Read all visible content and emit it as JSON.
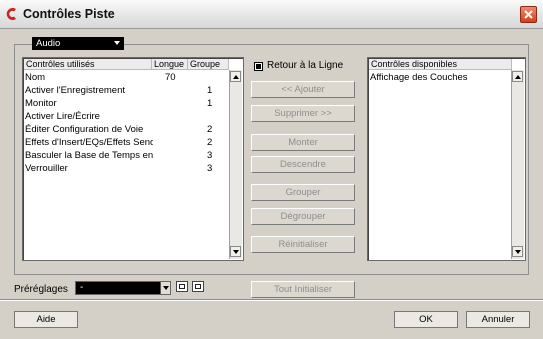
{
  "window": {
    "title": "Contrôles Piste"
  },
  "track_type_dropdown": {
    "value": "Audio"
  },
  "used_controls": {
    "headers": [
      "Contrôles utilisés",
      "Longue",
      "Groupe"
    ],
    "rows": [
      {
        "name": "Nom",
        "longue": "70",
        "groupe": ""
      },
      {
        "name": "Activer l'Enregistrement",
        "longue": "",
        "groupe": "1"
      },
      {
        "name": "Monitor",
        "longue": "",
        "groupe": "1"
      },
      {
        "name": "Activer Lire/Écrire",
        "longue": "",
        "groupe": ""
      },
      {
        "name": "Éditer Configuration de Voie",
        "longue": "",
        "groupe": "2"
      },
      {
        "name": "Effets d'Insert/EQs/Effets Send",
        "longue": "",
        "groupe": "2"
      },
      {
        "name": "Basculer la Base de Temps enti",
        "longue": "",
        "groupe": "3"
      },
      {
        "name": "Verrouiller",
        "longue": "",
        "groupe": "3"
      }
    ]
  },
  "wrap_checkbox": {
    "label": "Retour à la Ligne",
    "checked": true
  },
  "buttons": {
    "add": "<< Ajouter",
    "remove": "Supprimer >>",
    "move_up": "Monter",
    "move_down": "Descendre",
    "group": "Grouper",
    "ungroup": "Dégrouper",
    "reset": "Réinitialiser",
    "reset_all": "Tout Initialiser",
    "help": "Aide",
    "ok": "OK",
    "cancel": "Annuler"
  },
  "available_controls": {
    "header": "Contrôles disponibles",
    "rows": [
      "Affichage des Couches"
    ]
  },
  "presets": {
    "label": "Préréglages",
    "value": "-"
  }
}
